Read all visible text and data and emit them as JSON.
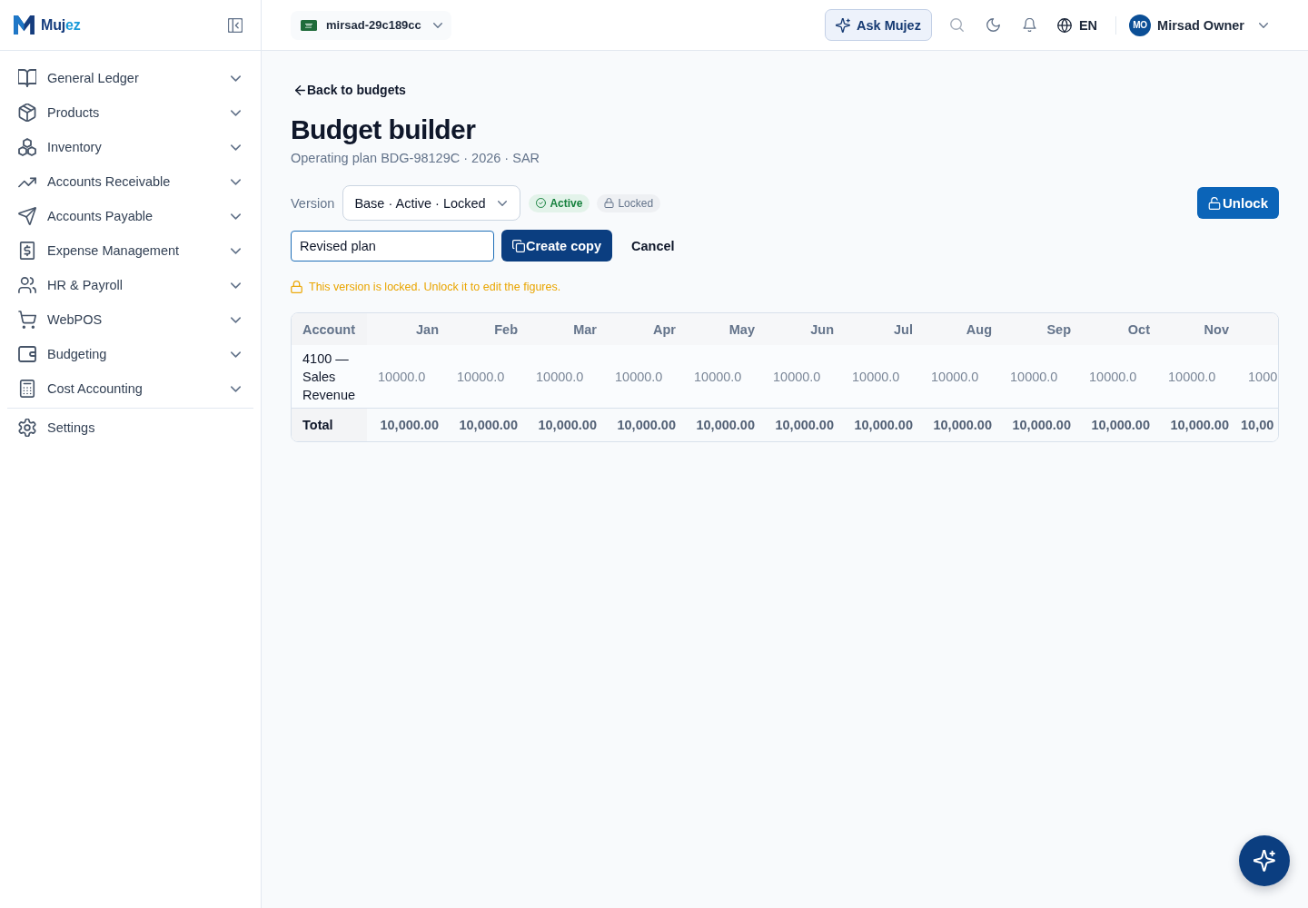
{
  "sidebar": {
    "brand": [
      {
        "text": "Muj",
        "color": "#163d7e"
      },
      {
        "text": "ez",
        "color": "#1a9ad9"
      }
    ],
    "items": [
      {
        "label": "General Ledger",
        "expanded": false
      },
      {
        "label": "Products",
        "expanded": false
      },
      {
        "label": "Inventory",
        "expanded": false
      },
      {
        "label": "Accounts Receivable",
        "expanded": false
      },
      {
        "label": "Accounts Payable",
        "expanded": false
      },
      {
        "label": "Expense Management",
        "expanded": false
      },
      {
        "label": "HR & Payroll",
        "expanded": false
      },
      {
        "label": "WebPOS",
        "expanded": false
      },
      {
        "label": "Budgeting",
        "expanded": false
      },
      {
        "label": "Cost Accounting",
        "expanded": false
      }
    ],
    "footer_items": [
      {
        "label": "Settings"
      }
    ]
  },
  "topbar": {
    "organization": "mirsad-29c189cc",
    "ask_button": "Ask Mujez",
    "language": "EN",
    "user": {
      "initials": "MO",
      "name": "Mirsad Owner"
    }
  },
  "page": {
    "back_link": "Back to budgets",
    "title": "Budget builder",
    "subtitle": "Operating plan BDG-98129C · 2026 · SAR",
    "version": {
      "label": "Version",
      "value": "Base · Active · Locked"
    },
    "badges": [
      {
        "kind": "active",
        "label": "Active"
      },
      {
        "kind": "locked",
        "label": "Locked"
      }
    ],
    "unlock_button": "Unlock",
    "copy_name": {
      "value": "Revised plan"
    },
    "create_copy_button": "Create copy",
    "cancel_button": "Cancel",
    "notice": "This version is locked. Unlock it to edit the figures."
  },
  "table": {
    "columns": [
      "Account",
      "Jan",
      "Feb",
      "Mar",
      "Apr",
      "May",
      "Jun",
      "Jul",
      "Aug",
      "Sep",
      "Oct",
      "Nov"
    ],
    "rows": [
      {
        "account": "4100 — Sales Revenue",
        "disabled": true,
        "values": [
          "10000.0",
          "10000.0",
          "10000.0",
          "10000.0",
          "10000.0",
          "10000.0",
          "10000.0",
          "10000.0",
          "10000.0",
          "10000.0",
          "10000.0",
          "1000"
        ]
      }
    ],
    "total": {
      "label": "Total",
      "values": [
        "10,000.00",
        "10,000.00",
        "10,000.00",
        "10,000.00",
        "10,000.00",
        "10,000.00",
        "10,000.00",
        "10,000.00",
        "10,000.00",
        "10,000.00",
        "10,000.00",
        "10,00"
      ]
    }
  }
}
